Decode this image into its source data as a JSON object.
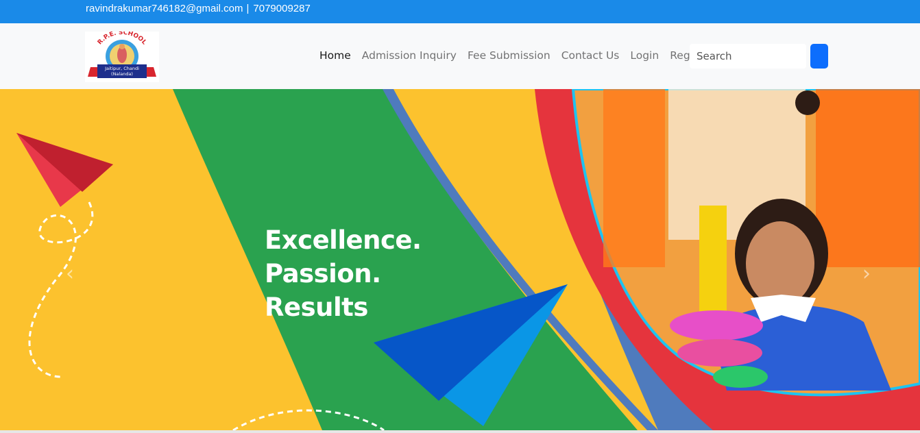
{
  "topbar": {
    "email": "ravindrakumar746182@gmail.com",
    "separator": "|",
    "phone": "7079009287"
  },
  "logo": {
    "school_name": "R.P.E. SCHOOL",
    "address_line1": "Jaitipur, Chandi",
    "address_line2": "(Nalanda)"
  },
  "nav": {
    "items": [
      {
        "label": "Home",
        "active": true
      },
      {
        "label": "Admission Inquiry"
      },
      {
        "label": "Fee Submission"
      },
      {
        "label": "Contact Us"
      },
      {
        "label": "Login"
      },
      {
        "label": "Register"
      }
    ],
    "search_placeholder": "Search"
  },
  "banner": {
    "tagline_1": "Excellence.",
    "tagline_2": "Passion.",
    "tagline_3": "Results",
    "prev_icon": "chevron-left-icon",
    "next_icon": "chevron-right-icon"
  },
  "colors": {
    "topbar": "#1a8ae8",
    "navbar": "#f8f9fa",
    "banner_yellow": "#fcc22e",
    "banner_green": "#2aa24f",
    "banner_blue": "#4f7bbd",
    "banner_red": "#e5343d",
    "search_button": "#0d6efd"
  }
}
